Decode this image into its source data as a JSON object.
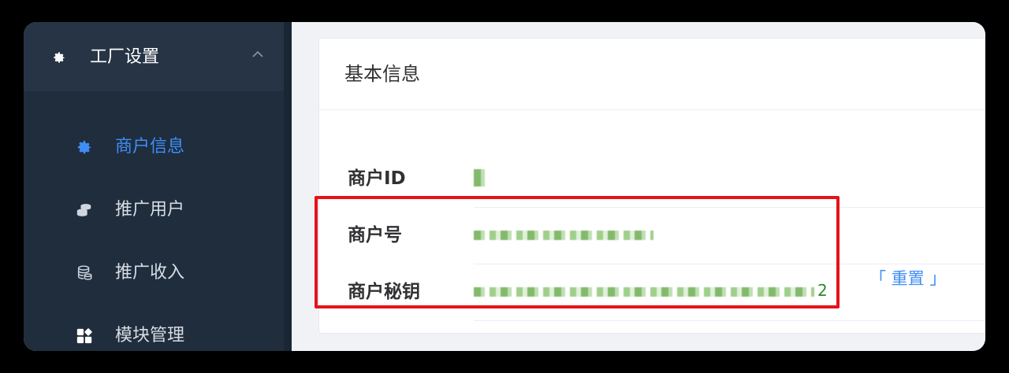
{
  "sidebar": {
    "group": {
      "label": "工厂设置",
      "icon": "gear-icon",
      "expanded": true
    },
    "items": [
      {
        "label": "商户信息",
        "icon": "gear-icon",
        "active": true
      },
      {
        "label": "推广用户",
        "icon": "coins-icon",
        "active": false
      },
      {
        "label": "推广收入",
        "icon": "database-icon",
        "active": false
      },
      {
        "label": "模块管理",
        "icon": "apps-icon",
        "active": false
      }
    ]
  },
  "main": {
    "card_title": "基本信息",
    "fields": [
      {
        "label": "商户ID",
        "value_tail": ""
      },
      {
        "label": "商户号",
        "value_tail": ""
      },
      {
        "label": "商户秘钥",
        "value_tail": "2"
      }
    ],
    "reset_link": "「 重置 」"
  },
  "colors": {
    "sidebar_bg": "#1f2d3d",
    "accent": "#3f8ef7",
    "highlight": "#e4131a"
  }
}
